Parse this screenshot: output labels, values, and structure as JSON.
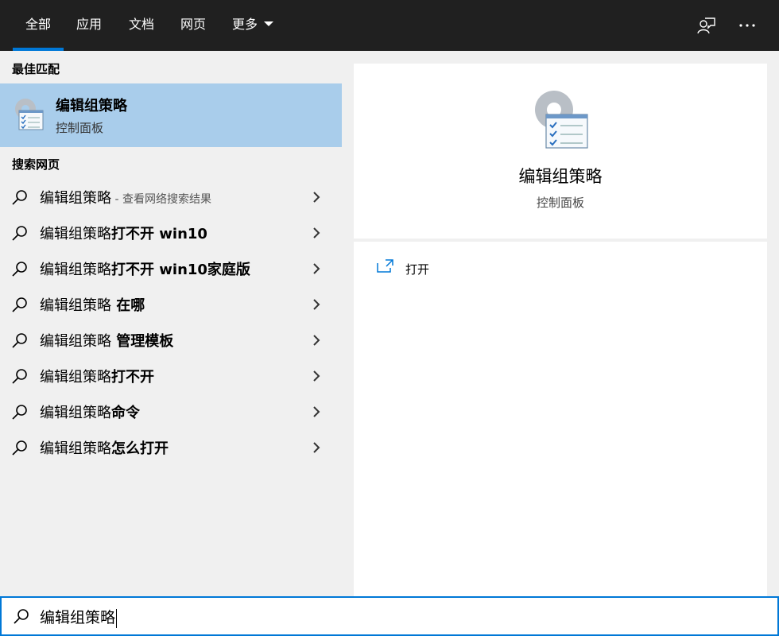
{
  "tabs": [
    {
      "label": "全部",
      "active": true
    },
    {
      "label": "应用"
    },
    {
      "label": "文档"
    },
    {
      "label": "网页"
    },
    {
      "label": "更多"
    }
  ],
  "header_icons": [
    "feedback-icon",
    "more-options-icon"
  ],
  "left": {
    "best_match_title": "最佳匹配",
    "best_match": {
      "title": "编辑组策略",
      "subtitle": "控制面板",
      "icon": "group-policy-icon"
    },
    "web_title": "搜索网页",
    "web_results": [
      {
        "prefix": "编辑组策略",
        "bold": "",
        "hint": " - 查看网络搜索结果"
      },
      {
        "prefix": "编辑组策略",
        "bold": "打不开 win10",
        "hint": ""
      },
      {
        "prefix": "编辑组策略",
        "bold": "打不开 win10家庭版",
        "hint": ""
      },
      {
        "prefix": "编辑组策略",
        "bold": " 在哪",
        "hint": ""
      },
      {
        "prefix": "编辑组策略",
        "bold": " 管理模板",
        "hint": ""
      },
      {
        "prefix": "编辑组策略",
        "bold": "打不开",
        "hint": ""
      },
      {
        "prefix": "编辑组策略",
        "bold": "命令",
        "hint": ""
      },
      {
        "prefix": "编辑组策略",
        "bold": "怎么打开",
        "hint": ""
      }
    ]
  },
  "right": {
    "title": "编辑组策略",
    "subtitle": "控制面板",
    "actions": [
      {
        "label": "打开",
        "icon": "open-icon"
      }
    ]
  },
  "search": {
    "value": "编辑组策略"
  },
  "colors": {
    "topbar": "#202020",
    "accent": "#0078d7",
    "selected": "#a9cdeb",
    "panel": "#f0f0f0"
  }
}
